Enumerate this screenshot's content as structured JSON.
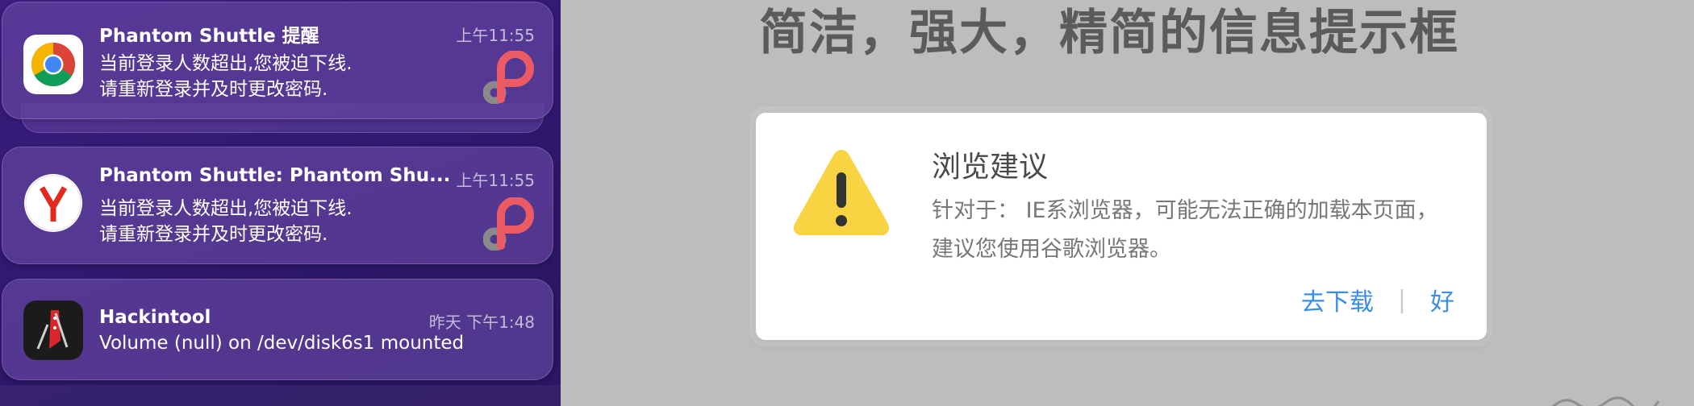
{
  "notifications": [
    {
      "app": "Phantom Shuttle 提醒",
      "time": "上午11:55",
      "line1": "当前登录人数超出,您被迫下线.",
      "line2": "请重新登录并及时更改密码.",
      "icon": "chrome-icon"
    },
    {
      "app": "Phantom Shuttle: Phantom Shu...",
      "time": "上午11:55",
      "line1": "当前登录人数超出,您被迫下线.",
      "line2": "请重新登录并及时更改密码.",
      "icon": "yandex-browser-icon"
    },
    {
      "app": "Hackintool",
      "time": "昨天 下午1:48",
      "line1": "Volume (null) on /dev/disk6s1 mounted",
      "icon": "hackintool-icon"
    }
  ],
  "page": {
    "title": "简洁，强大，精简的信息提示框"
  },
  "dialog": {
    "title": "浏览建议",
    "body": "针对于： IE系浏览器，可能无法正确的加载本页面，建议您使用谷歌浏览器。",
    "download_label": "去下载",
    "separator": "|",
    "ok_label": "好",
    "warning_color": "#f8d342",
    "link_color": "#3a8ee6"
  }
}
